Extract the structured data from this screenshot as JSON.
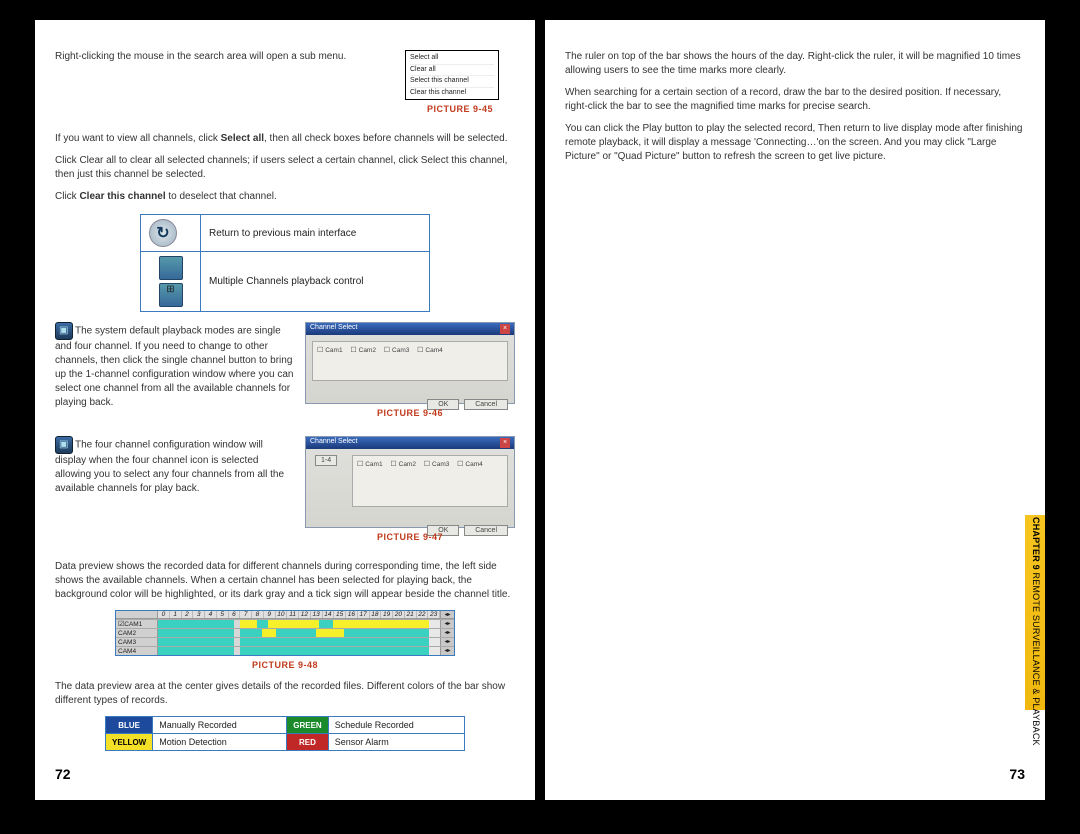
{
  "left": {
    "intro": "Right-clicking the mouse in the search area will open a sub menu.",
    "menu": [
      "Select all",
      "Clear all",
      "Select this channel",
      "Clear this channel"
    ],
    "cap45": "PICTURE 9-45",
    "p1a": "If you want to view all channels, click ",
    "p1b": "Select all",
    "p1c": ", then all check boxes before channels will be selected.",
    "p2": "Click Clear all to clear all selected channels; if users select a certain channel, click Select this channel, then just this channel be selected.",
    "p3a": "Click ",
    "p3b": "Clear this channel",
    "p3c": " to deselect that channel.",
    "tbl": [
      {
        "desc": "Return to previous main interface"
      },
      {
        "desc": "Multiple Channels playback control"
      }
    ],
    "p4": "The system default playback modes are single and four channel. If you need to change to other channels, then click the single channel button to bring up the 1-channel configuration window where you can select one channel from all the available channels for playing back.",
    "cap46": "PICTURE 9-46",
    "p5": "The four channel configuration window will display when the four channel icon is selected allowing you to select any four channels from all the available channels for play back.",
    "cap47": "PICTURE 9-47",
    "p6": "Data preview shows the recorded data for different channels during corresponding time, the left side shows the available channels. When a certain channel has been selected for playing back, the background color will be highlighted, or its dark gray and a tick sign will appear beside the channel title.",
    "timeline": {
      "ticks": [
        "0",
        "1",
        "2",
        "3",
        "4",
        "5",
        "6",
        "7",
        "8",
        "9",
        "10",
        "11",
        "12",
        "13",
        "14",
        "15",
        "16",
        "17",
        "18",
        "19",
        "20",
        "21",
        "22",
        "23"
      ],
      "rows": [
        "CAM1",
        "CAM2",
        "CAM3",
        "CAM4"
      ]
    },
    "cap48": "PICTURE 9-48",
    "p7": "The data preview area at the center gives details of the recorded files. Different colors of the bar show different types of records.",
    "legend": {
      "blue": {
        "tag": "BLUE",
        "txt": "Manually Recorded"
      },
      "green": {
        "tag": "GREEN",
        "txt": "Schedule Recorded"
      },
      "yellow": {
        "tag": "YELLOW",
        "txt": "Motion Detection"
      },
      "red": {
        "tag": "RED",
        "txt": "Sensor Alarm"
      }
    },
    "screenshot": {
      "title": "Channel Select",
      "ch": [
        "Cam1",
        "Cam2",
        "Cam3",
        "Cam4"
      ],
      "ok": "OK",
      "cancel": "Cancel",
      "btn14": "1-4"
    },
    "pagenum": "72"
  },
  "right": {
    "p1": "The ruler on top of the bar shows the hours of the day. Right-click the ruler, it will be magnified 10 times allowing users to see the time marks more clearly.",
    "p2": "When searching for a certain section of a record, draw the bar to the desired position. If necessary, right-click the bar to see the magnified time marks for precise search.",
    "p3": "You can click the Play button to play the selected record, Then return to live display mode after finishing remote playback, it will display a message 'Connecting…'on the screen. And you may click \"Large Picture\" or \"Quad Picture\" button to refresh the screen to get live picture.",
    "pagenum": "73",
    "sidetab": {
      "chapter": "CHAPTER 9",
      "title": "REMOTE SURVEILLANCE & PLAYBACK"
    }
  }
}
